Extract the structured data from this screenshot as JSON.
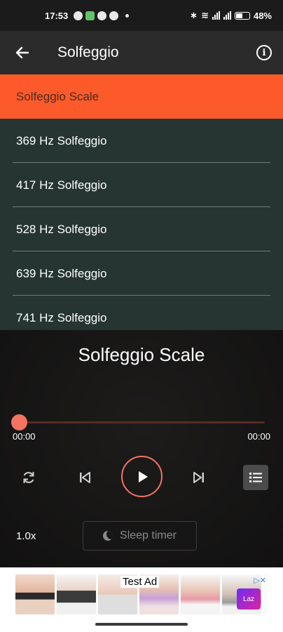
{
  "status_bar": {
    "time": "17:53",
    "battery": "48%"
  },
  "top_bar": {
    "title": "Solfeggio"
  },
  "list": {
    "items": [
      {
        "label": "Solfeggio Scale",
        "active": true
      },
      {
        "label": "369 Hz Solfeggio",
        "active": false
      },
      {
        "label": "417 Hz Solfeggio",
        "active": false
      },
      {
        "label": "528 Hz Solfeggio",
        "active": false
      },
      {
        "label": "639 Hz Solfeggio",
        "active": false
      },
      {
        "label": "741 Hz Solfeggio",
        "active": false
      }
    ]
  },
  "player": {
    "now_playing": "Solfeggio Scale",
    "elapsed": "00:00",
    "duration": "00:00",
    "progress": 0,
    "speed": "1.0x",
    "sleep_timer_label": "Sleep timer"
  },
  "ad": {
    "label": "Test Ad",
    "logo_text": "Laz"
  },
  "colors": {
    "accent": "#fc5a2b",
    "seek": "#f47361",
    "list_bg": "#263532"
  }
}
